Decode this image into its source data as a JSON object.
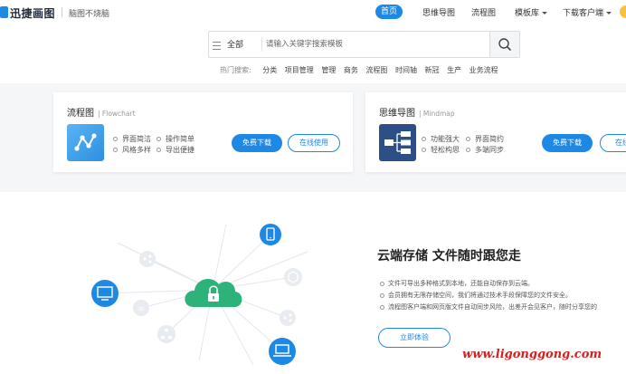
{
  "header": {
    "logo_text": "迅捷画图",
    "slogan": "脑图不烧脑",
    "nav": {
      "home": "首页",
      "mindmap": "思维导图",
      "flowchart": "流程图",
      "templates": "模板库",
      "download_client": "下载客户端"
    }
  },
  "search": {
    "scope": "全部",
    "placeholder": "请输入关键字搜索模板",
    "hot_label": "热门搜索:",
    "hot_terms": [
      "分类",
      "项目管理",
      "管理",
      "商务",
      "流程图",
      "时间轴",
      "新冠",
      "生产",
      "业务流程"
    ]
  },
  "cards": [
    {
      "title": "流程图",
      "subtitle": "Flowchart",
      "features": [
        "界面简洁",
        "操作简单",
        "风格多样",
        "导出便捷"
      ],
      "download_label": "免费下载",
      "online_label": "在线使用"
    },
    {
      "title": "思维导图",
      "subtitle": "Mindmap",
      "features": [
        "功能强大",
        "界面简约",
        "轻松构思",
        "多端同步"
      ],
      "download_label": "免费下载",
      "online_label": "在线使"
    }
  ],
  "storage": {
    "title": "云端存储 文件随时跟您走",
    "lines": [
      "文件可导出多种格式到本地，还能自动保存到云端。",
      "会员拥有无限存储空间，我们将通过技术手段保障您的文件安全。",
      "流程图客户端和网页版文件自动同步风险，出差开会见客户，随时分享您的"
    ],
    "cta": "立即体验"
  },
  "watermark": "www.ligonggong.com",
  "colors": {
    "brand_blue": "#1e88e5",
    "cloud_green": "#2db37a",
    "watermark_red": "#d42020",
    "section_bg": "#f5f6f8"
  },
  "icons": [
    "logo-icon",
    "search-icon",
    "menu-icon",
    "flowchart-app-icon",
    "mindmap-app-icon",
    "cloud-lock-icon",
    "monitor-icon",
    "phone-icon",
    "laptop-icon"
  ]
}
